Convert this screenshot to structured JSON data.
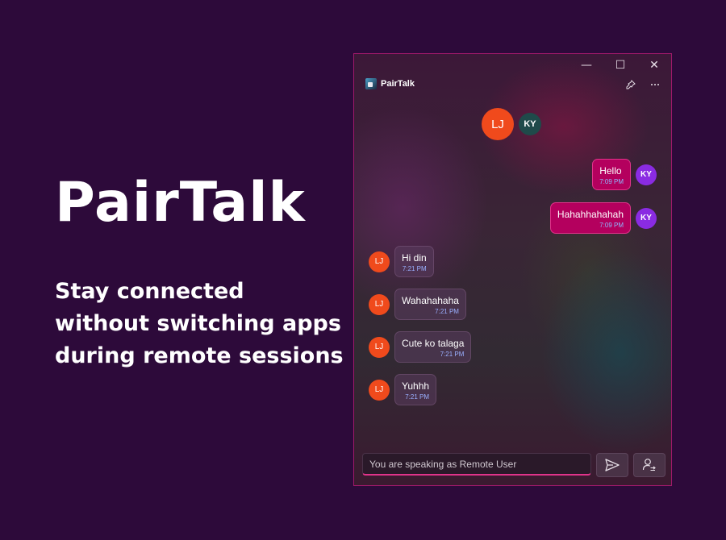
{
  "hero": {
    "title": "PairTalk",
    "subtitle": "Stay connected without switching apps during remote sessions"
  },
  "window": {
    "controls": {
      "minimize": "—",
      "maximize": "☐",
      "close": "✕"
    },
    "app_title": "PairTalk",
    "icons": {
      "logo": "app-logo-icon",
      "pin": "pin-icon",
      "more": "more-icon",
      "send": "send-icon",
      "user_switch": "user-switch-icon"
    }
  },
  "participants": {
    "primary": "LJ",
    "secondary": "KY"
  },
  "messages": [
    {
      "sender": "KY",
      "text": "Hello",
      "time": "7:09 PM",
      "outgoing": true
    },
    {
      "sender": "KY",
      "text": "Hahahhahahah",
      "time": "7:09 PM",
      "outgoing": true
    },
    {
      "sender": "LJ",
      "text": "Hi din",
      "time": "7:21 PM",
      "outgoing": false
    },
    {
      "sender": "LJ",
      "text": "Wahahahaha",
      "time": "7:21 PM",
      "outgoing": false
    },
    {
      "sender": "LJ",
      "text": "Cute ko talaga",
      "time": "7:21 PM",
      "outgoing": false
    },
    {
      "sender": "LJ",
      "text": "Yuhhh",
      "time": "7:21 PM",
      "outgoing": false
    }
  ],
  "composer": {
    "placeholder": "You are speaking as Remote User"
  },
  "colors": {
    "background": "#2d0a3a",
    "outgoing_bubble": "#b4005e",
    "lj_avatar": "#f04a1c",
    "ky_avatar": "#8a2be2",
    "accent": "#e0338a"
  }
}
